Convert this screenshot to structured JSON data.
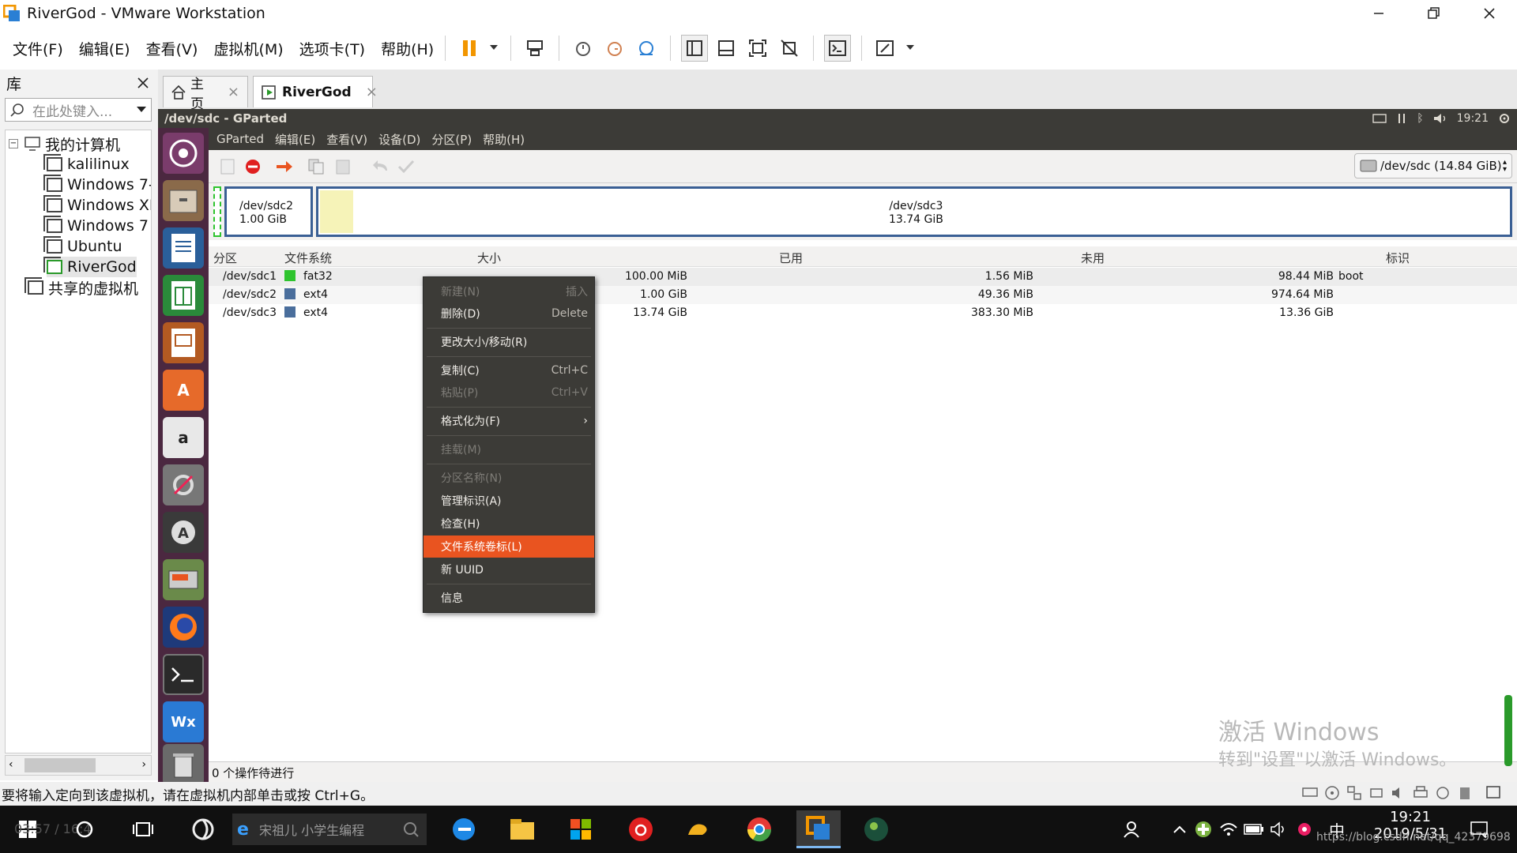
{
  "window": {
    "title": "RiverGod - VMware Workstation"
  },
  "menubar": {
    "items": [
      "文件(F)",
      "编辑(E)",
      "查看(V)",
      "虚拟机(M)",
      "选项卡(T)",
      "帮助(H)"
    ]
  },
  "library": {
    "title": "库",
    "search_placeholder": "在此处键入...",
    "root": "我的计算机",
    "vms": [
      "kalilinux",
      "Windows 7-",
      "Windows XI",
      "Windows 7",
      "Ubuntu",
      "RiverGod"
    ],
    "shared": "共享的虚拟机"
  },
  "tabs": [
    {
      "label": "主页"
    },
    {
      "label": "RiverGod"
    }
  ],
  "ubuntu": {
    "window_title": "/dev/sdc - GParted",
    "clock": "19:21"
  },
  "gparted": {
    "menu": [
      "GParted",
      "编辑(E)",
      "查看(V)",
      "设备(D)",
      "分区(P)",
      "帮助(H)"
    ],
    "device": "/dev/sdc  (14.84 GiB)",
    "map": {
      "p2": {
        "name": "/dev/sdc2",
        "size": "1.00 GiB"
      },
      "p3": {
        "name": "/dev/sdc3",
        "size": "13.74 GiB"
      }
    },
    "columns": [
      "分区",
      "文件系统",
      "大小",
      "已用",
      "未用",
      "标识"
    ],
    "rows": [
      {
        "partition": "/dev/sdc1",
        "fs": "fat32",
        "fs_color": "#2ec42e",
        "size": "100.00 MiB",
        "used": "1.56 MiB",
        "unused": "98.44 MiB",
        "flags": "boot"
      },
      {
        "partition": "/dev/sdc2",
        "fs": "ext4",
        "fs_color": "#4a6e9c",
        "size": "1.00 GiB",
        "used": "49.36 MiB",
        "unused": "974.64 MiB",
        "flags": ""
      },
      {
        "partition": "/dev/sdc3",
        "fs": "ext4",
        "fs_color": "#4a6e9c",
        "size": "13.74 GiB",
        "used": "383.30 MiB",
        "unused": "13.36 GiB",
        "flags": ""
      }
    ],
    "status": "0 个操作待进行"
  },
  "context_menu": {
    "items": [
      {
        "label": "新建(N)",
        "accel": "插入",
        "disabled": true
      },
      {
        "label": "删除(D)",
        "accel": "Delete",
        "disabled": false
      },
      {
        "label": "更改大小/移动(R)",
        "accel": "",
        "disabled": false
      },
      {
        "label": "复制(C)",
        "accel": "Ctrl+C",
        "disabled": false
      },
      {
        "label": "粘贴(P)",
        "accel": "Ctrl+V",
        "disabled": true
      },
      {
        "label": "格式化为(F)",
        "accel": "›",
        "disabled": false
      },
      {
        "label": "挂载(M)",
        "accel": "",
        "disabled": true
      },
      {
        "label": "分区名称(N)",
        "accel": "",
        "disabled": true
      },
      {
        "label": "管理标识(A)",
        "accel": "",
        "disabled": false
      },
      {
        "label": "检查(H)",
        "accel": "",
        "disabled": false
      },
      {
        "label": "文件系统卷标(L)",
        "accel": "",
        "disabled": false,
        "highlighted": true
      },
      {
        "label": "新 UUID",
        "accel": "",
        "disabled": false
      },
      {
        "label": "信息",
        "accel": "",
        "disabled": false
      }
    ]
  },
  "watermark": {
    "line1": "激活 Windows",
    "line2": "转到\"设置\"以激活 Windows。"
  },
  "vm_status": "要将输入定向到该虚拟机，请在虚拟机内部单击或按 Ctrl+G。",
  "taskbar": {
    "search_placeholder": "宋祖儿 小学生编程",
    "time": "19:21",
    "date": "2019/5/31",
    "ime": "中",
    "left_overlay": "03:57 / 16:4",
    "url_overlay": "https://blog.csdn.net/qq_42379698"
  },
  "colors": {
    "ubuntu_orange": "#e95420",
    "launcher": "#4b2840",
    "panel": "#3c3b37",
    "vmware_accent": "#f29600"
  }
}
